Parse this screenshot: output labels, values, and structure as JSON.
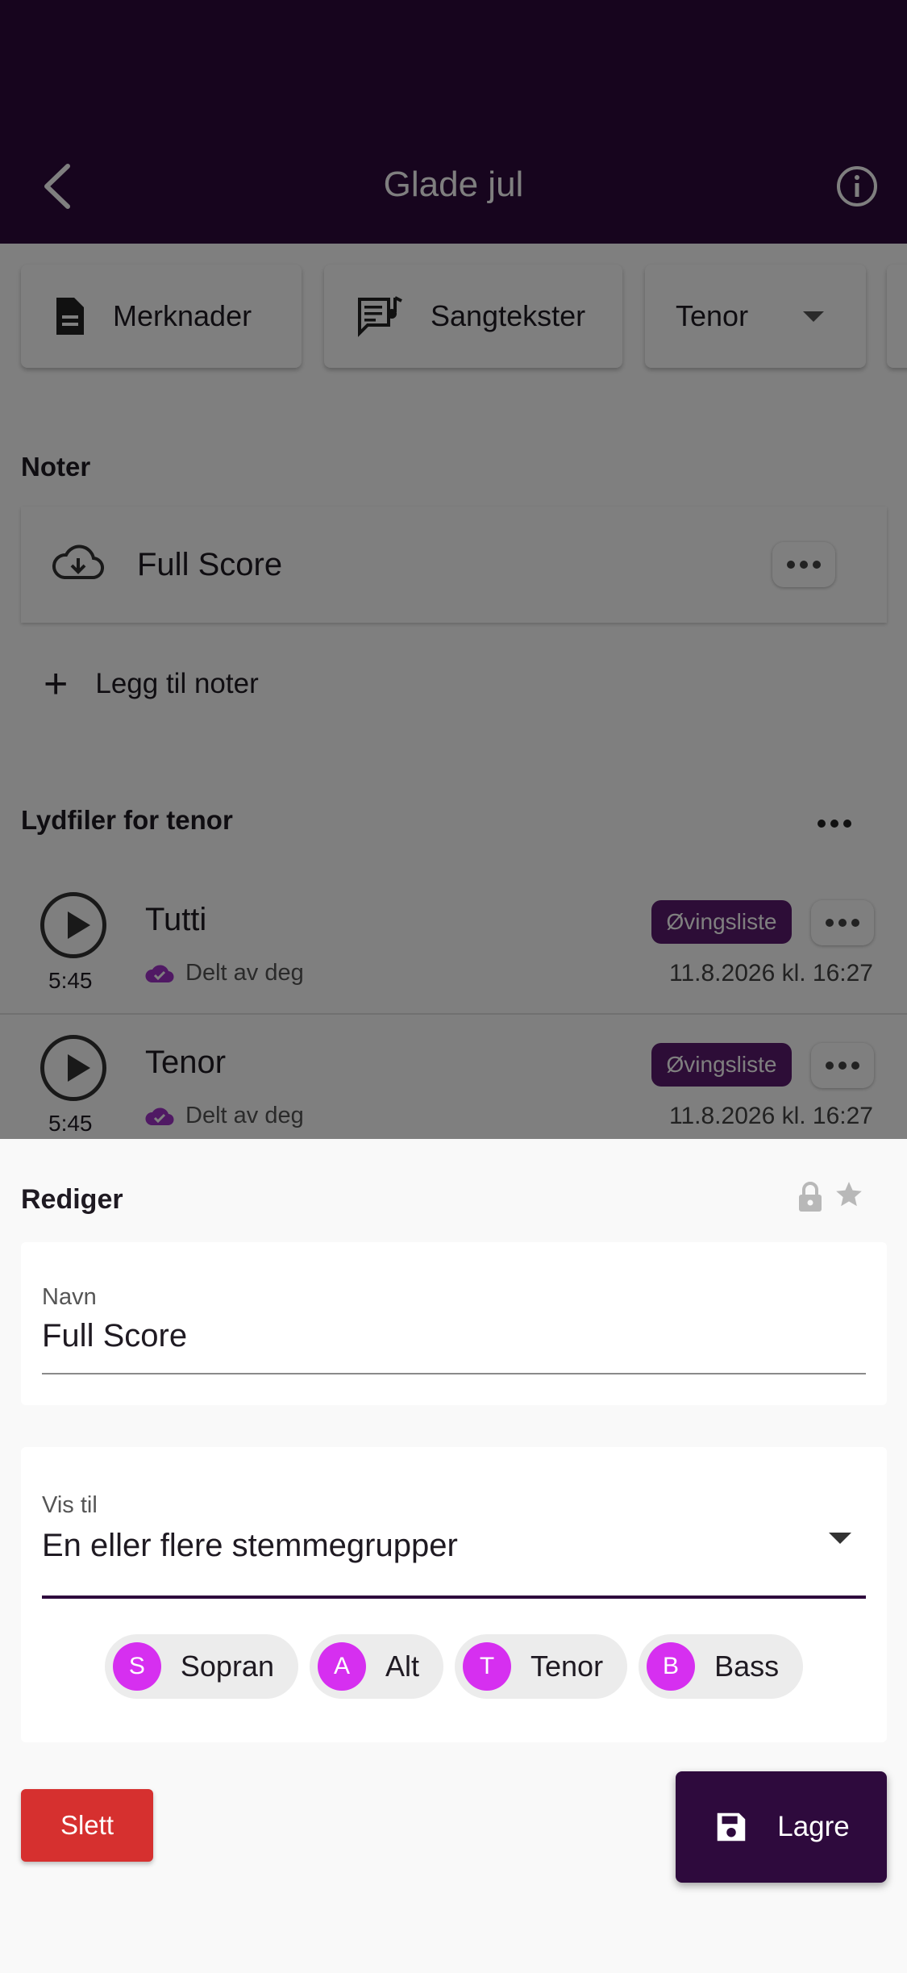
{
  "appbar": {
    "title": "Glade jul"
  },
  "actions": {
    "notes_label": "Merknader",
    "lyrics_label": "Sangtekster",
    "voice_select": "Tenor"
  },
  "notes_section": {
    "title": "Noter",
    "item_label": "Full Score",
    "add_label": "Legg til noter"
  },
  "audio_section": {
    "title": "Lydfiler for tenor",
    "items": [
      {
        "name": "Tutti",
        "duration": "5:45",
        "shared": "Delt av deg",
        "badge": "Øvingsliste",
        "date": "11.8.2026 kl. 16:27"
      },
      {
        "name": "Tenor",
        "duration": "5:45",
        "shared": "Delt av deg",
        "badge": "Øvingsliste",
        "date": "11.8.2026 kl. 16:27"
      }
    ]
  },
  "sheet": {
    "title": "Rediger",
    "name_label": "Navn",
    "name_value": "Full Score",
    "visibility_label": "Vis til",
    "visibility_value": "En eller flere stemmegrupper",
    "voices": [
      {
        "initial": "S",
        "label": "Sopran"
      },
      {
        "initial": "A",
        "label": "Alt"
      },
      {
        "initial": "T",
        "label": "Tenor"
      },
      {
        "initial": "B",
        "label": "Bass"
      }
    ],
    "delete_label": "Slett",
    "save_label": "Lagre"
  },
  "colors": {
    "primary": "#2e0a3d",
    "accent": "#d62ff0",
    "danger": "#d6302f",
    "badge": "#5a1a6e"
  }
}
